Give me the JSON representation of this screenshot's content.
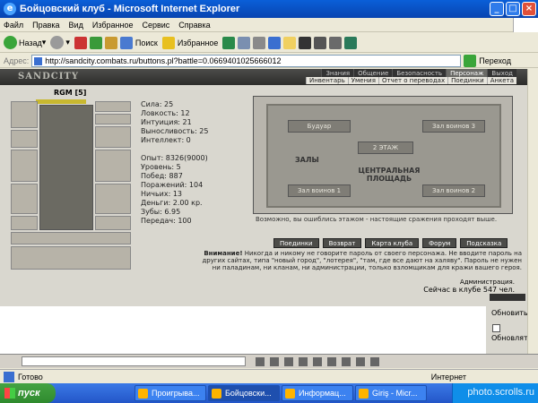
{
  "window": {
    "title": "Бойцовский клуб - Microsoft Internet Explorer"
  },
  "menu": [
    "Файл",
    "Правка",
    "Вид",
    "Избранное",
    "Сервис",
    "Справка"
  ],
  "toolbar": {
    "back": "Назад",
    "search": "Поиск",
    "favorites": "Избранное"
  },
  "address": {
    "label": "Адрес:",
    "url": "http://sandcity.combats.ru/buttons.pl?battle=0.0669401025666012",
    "go": "Переход"
  },
  "site": {
    "logo": "SANDCITY",
    "tabs": [
      "Знания",
      "Общение",
      "Безопасность",
      "Персонаж",
      "Выход"
    ],
    "subtabs": [
      "Инвентарь",
      "Умения",
      "Отчет о переводах",
      "Поединки",
      "Анкета"
    ]
  },
  "character": {
    "name": "RGM [5]",
    "hp_fraction": 1.0,
    "stats": [
      "Сила: 25",
      "Ловкость: 12",
      "Интуиция: 21",
      "Выносливость: 25",
      "Интеллект: 0",
      "",
      "Опыт: 8326(9000)",
      "Уровень: 5",
      "Побед: 887",
      "Поражений: 104",
      "Ничьих: 13",
      "Деньги: 2.00 кр.",
      "Зубы: 6.95",
      "Передач: 100"
    ]
  },
  "map": {
    "buttons": [
      "Будуар",
      "Зал воинов 3",
      "Зал воинов 1",
      "Зал воинов 2"
    ],
    "floor": "2 ЭТАЖ",
    "halls": "ЗАЛЫ",
    "center": "ЦЕНТРАЛЬНАЯ ПЛОЩАДЬ",
    "note": "Возможно, вы ошиблись этажом - настоящие сражения проходят выше."
  },
  "game_buttons": [
    "Поединки",
    "Возврат",
    "Карта клуба",
    "Форум",
    "Подсказка"
  ],
  "warning": {
    "lead": "Внимание!",
    "text": "Никогда и никому не говорите пароль от своего персонажа. Не вводите пароль на других сайтах, типа \"новый город\", \"лотерея\", \"там, где все дают на халяву\". Пароль не нужен ни паладинам, ни кланам, ни администрации, только взломщикам для кражи вашего героя."
  },
  "admin_label": "Администрация.",
  "online": "Сейчас в клубе 547 чел.",
  "chat": {
    "refresh": "Обновить",
    "refresh2": "Обновлять"
  },
  "status": {
    "ready": "Готово",
    "zone": "Интернет"
  },
  "taskbar": {
    "start": "пуск",
    "tasks": [
      "Проигрыва...",
      "Бойцовски...",
      "Информац...",
      "Giriş - Micr..."
    ]
  },
  "watermark": "photo.scrolls.ru"
}
